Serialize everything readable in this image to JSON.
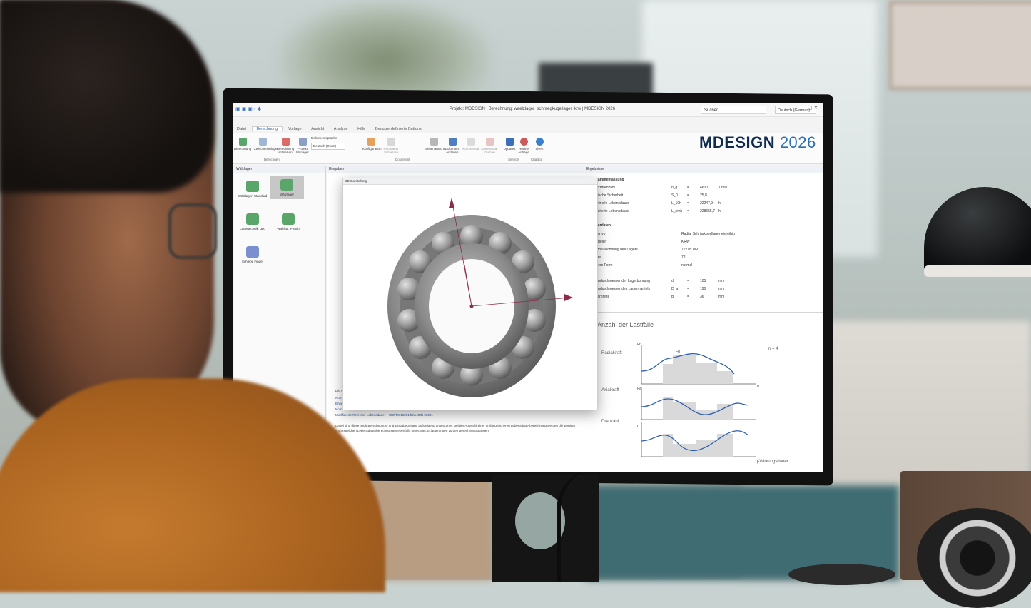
{
  "app": {
    "title": "Projekt: MDESIGN | Berechnung: waelzlager_schraegkugellager_krw | MDESIGN 2026",
    "logo_main": "MDESIGN",
    "logo_year": "2026",
    "search_placeholder": "Suchen...",
    "language": "Deutsch (German)",
    "brand_color": "#0f2b52",
    "accent_color": "#2a6fb3"
  },
  "tabs": [
    "Datei",
    "Berechnung",
    "Vorlage",
    "Ansicht",
    "Analyse",
    "Hilfe",
    "Benutzerdefinierte Buttons"
  ],
  "ribbon": {
    "buttons": [
      "Berechnung",
      "Zwischenablage",
      "Berechnung schließen",
      "Projekt Manager",
      "Konfiguration",
      "Parameter Schließen",
      "Seitenansicht",
      "Dokument erstellen",
      "Kommentar",
      "Kommentar löschen",
      "Updates",
      "Hotline Anfrage",
      "aiven"
    ],
    "doc_language_label": "Dokumentsprache",
    "doc_language_value": "Deutsch (Germ)",
    "groups": [
      "Berechnen",
      "Dokument",
      "Service",
      "ChatBot"
    ]
  },
  "left_panel": {
    "title": "Wälzlager",
    "items": [
      "Wälzlager, Standard",
      "Wälzlager",
      "Lagertechnik, gpo",
      "Wälzlag. Prenio",
      "Schiebe Finder"
    ]
  },
  "middle_panel": {
    "title": "Eingaben",
    "intro": "Die Auswahl der Berechnung:",
    "list": [
      "Nominelle Lebensdauer – DIN 281",
      "Erweiterte Lebensdauer – DIN 281",
      "Nominelle Referenz-Lebensdauer – ISO/TS 16281 bzw. DIN 26281",
      "Modifizierte Referenz-Lebensdauer – ISO/TS 16281 bzw. DIN 26281"
    ],
    "paragraph": "Dabei sind diese nach Berechnungs- und Eingabeumfang aufsteigend angeordnet. Bei der Auswahl einer umfangreicheren Lebensdauerberechnung werden die weniger umfangreichen Lebensdauerberechnungen ebenfalls berechnet. Erläuterungen zu den Berechnungsgängen:"
  },
  "window_3d": {
    "title": "3D-Darstellung"
  },
  "results": {
    "title": "Ergebnisse",
    "section1": "Zusammenfassung",
    "rows": [
      {
        "label": "Grenzdrehzahl",
        "symbol": "n_g",
        "value": "4600",
        "unit": "1/min"
      },
      {
        "label": "Statische Sicherheit",
        "symbol": "S_0",
        "value": "25,8",
        "unit": ""
      },
      {
        "label": "Nominelle Lebensdauer",
        "symbol": "L_10h",
        "value": "22247,9",
        "unit": "h"
      },
      {
        "label": "Erweiterte Lebensdauer",
        "symbol": "L_nmh",
        "value": "228655,7",
        "unit": "h"
      }
    ],
    "section2": "Lagerdaten",
    "info": [
      {
        "label": "Lagertyp",
        "value": "Radial Schrägkugellager einreihig"
      },
      {
        "label": "Hersteller",
        "value": "KRW"
      },
      {
        "label": "Kurzbezeichnung des Lagers",
        "value": "7221B.MP"
      },
      {
        "label": "Reihe",
        "value": "72"
      },
      {
        "label": "Äußere Form",
        "value": "normal"
      }
    ],
    "dims": [
      {
        "label": "Nenndurchmesser der Lagerbohrung",
        "symbol": "d",
        "value": "105",
        "unit": "mm"
      },
      {
        "label": "Nenndurchmesser des Lagermantels",
        "symbol": "D_a",
        "value": "190",
        "unit": "mm"
      },
      {
        "label": "Lagerbreite",
        "symbol": "B",
        "value": "36",
        "unit": "mm"
      }
    ]
  },
  "load_panel": {
    "title": "Anzahl der Lastfälle",
    "rows": [
      "Radialkraft",
      "Axialkraft",
      "Drehzahl"
    ],
    "n_label": "n = 4",
    "x_label": "q-Wirkungsdauer",
    "q": "q"
  }
}
